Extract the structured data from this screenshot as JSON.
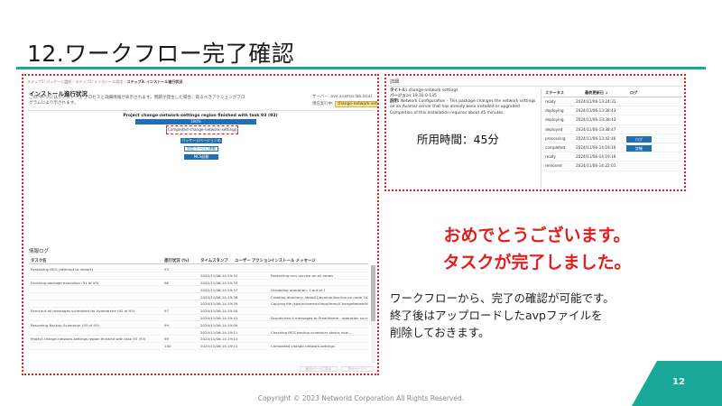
{
  "slide": {
    "title": "12.ワークフロー完了確認",
    "elapsed_time": "所用時間：45分",
    "congrats_line1": "おめでとうございます。",
    "congrats_line2": "タスクが完了しました。",
    "note_line1": "ワークフローから、完了の確認が可能です。",
    "note_line2": "終了後はアップロードしたavpファイルを",
    "note_line3": "削除しておきます。",
    "footer": "Copyright © 2023 Networld Corporation All Rights Reserved.",
    "page_number": "12",
    "accent_color": "#1aa89a",
    "highlight_color": "#e41e1e"
  },
  "left_screenshot": {
    "breadcrumb": [
      "ステップ1: パッケージ選択",
      "ステップ2: インストール設定",
      "ステップ3: インストール進行状況"
    ],
    "title": "インストール進行状況",
    "description": "このページにはインストール プロセスと詳細情報が表示されます。問題が発生した場合、取るべきアクションがプログラムにより示されます。",
    "server_label": "サーバー: ave.avamar.lab.local",
    "task_label": "現在実行中:",
    "task_value": "change-network-settings",
    "progress_title": "Project change-network-settings  region finished with task 93 (93)",
    "progress_percent": 100,
    "progress_text": "100%",
    "completed_text": "Completed change-network-settings",
    "btn_package_details": "パッケージバージョンの詳細",
    "btn_view_logs": "設定ページに移動",
    "btn_mcs": "MCS起動",
    "log_section_title": "情報ログ",
    "log_headers": [
      "タスク名",
      "進行状況 (%)",
      "タイムスタンプ",
      "ユーザー アクション",
      "インストール メッセージ"
    ],
    "log_rows": [
      {
        "task": "Restarting MCS (attempt to restart)",
        "pct": "93",
        "time": "",
        "msg": ""
      },
      {
        "task": "",
        "pct": "",
        "time": "2024/11/06-14:19:32",
        "msg": "Restarting mcs service on all nodes"
      },
      {
        "task": "Finishing package execution (91 of 93)",
        "pct": "96",
        "time": "2024/11/06-14:19:33",
        "msg": ""
      },
      {
        "task": "",
        "pct": "",
        "time": "2024/11/06-14:19:37",
        "msg": "Unloading operation: 1 out of 1"
      },
      {
        "task": "",
        "pct": "",
        "time": "2024/11/06-14:19:38",
        "msg": "Creating directory: /data01/avamar/backup on node 10.2.16.20 now"
      },
      {
        "task": "",
        "pct": "",
        "time": "2024/11/06-14:19:39",
        "msg": "Copying file /space/avamar/repo/temp/ChangeNetworkSettings-19.10.0.avp"
      },
      {
        "task": "Send out all messages scheduled for Avamarche (92 of 93)",
        "pct": "97",
        "time": "2024/11/06-14:19:40",
        "msg": ""
      },
      {
        "task": "",
        "pct": "",
        "time": "2024/11/06-14:19:41",
        "msg": "Dispatched 4 messages to EmailHome - operation succeeded"
      },
      {
        "task": "Resuming Backup Scheduler (93 of 93)",
        "pct": "99",
        "time": "2024/11/06-14:19:09",
        "msg": ""
      },
      {
        "task": "",
        "pct": "",
        "time": "2024/11/06-14:19:11",
        "msg": "Checking MCS backup scheduler status now..."
      },
      {
        "task": "Project change-network-settings region finished with task 93 (93)",
        "pct": "99",
        "time": "2024/11/06-14:19:14",
        "msg": ""
      },
      {
        "task": "",
        "pct": "100",
        "time": "2024/11/06-14:19:15",
        "msg": "Completed change-network-settings"
      }
    ],
    "pager_prev": "前のページに戻る",
    "pager_next": "次のページへ"
  },
  "right_screenshot": {
    "header": "詳細",
    "title_label": "タイトル:",
    "title_value": "change-network-settings",
    "version_label": "バージョン:",
    "version_value": "19.10.0-135",
    "desc_label": "説明:",
    "desc_value": "Network Configuration - This package changes the network settings on an Avamar server that has already been installed or upgraded. Completion of this installation requires about 45 minutes.",
    "table_headers": [
      "ステータス",
      "最終更新日 ↓",
      "ログ"
    ],
    "rows": [
      {
        "status": "ready",
        "date": "2024/11/06-13:24:31",
        "log": ""
      },
      {
        "status": "deploying",
        "date": "2024/11/06-13:38:43",
        "log": ""
      },
      {
        "status": "deploying",
        "date": "2024/11/06-13:38:43",
        "log": ""
      },
      {
        "status": "deployed",
        "date": "2024/11/06-13:38:47",
        "log": ""
      },
      {
        "status": "processing",
        "date": "2024/11/06-13:42:46",
        "log": "ログ"
      },
      {
        "status": "completed",
        "date": "2024/11/06-14:19:16",
        "log": "詳細"
      },
      {
        "status": "ready",
        "date": "2024/11/06-14:19:16",
        "log": ""
      },
      {
        "status": "removed",
        "date": "2024/11/06-14:22:01",
        "log": ""
      }
    ]
  }
}
